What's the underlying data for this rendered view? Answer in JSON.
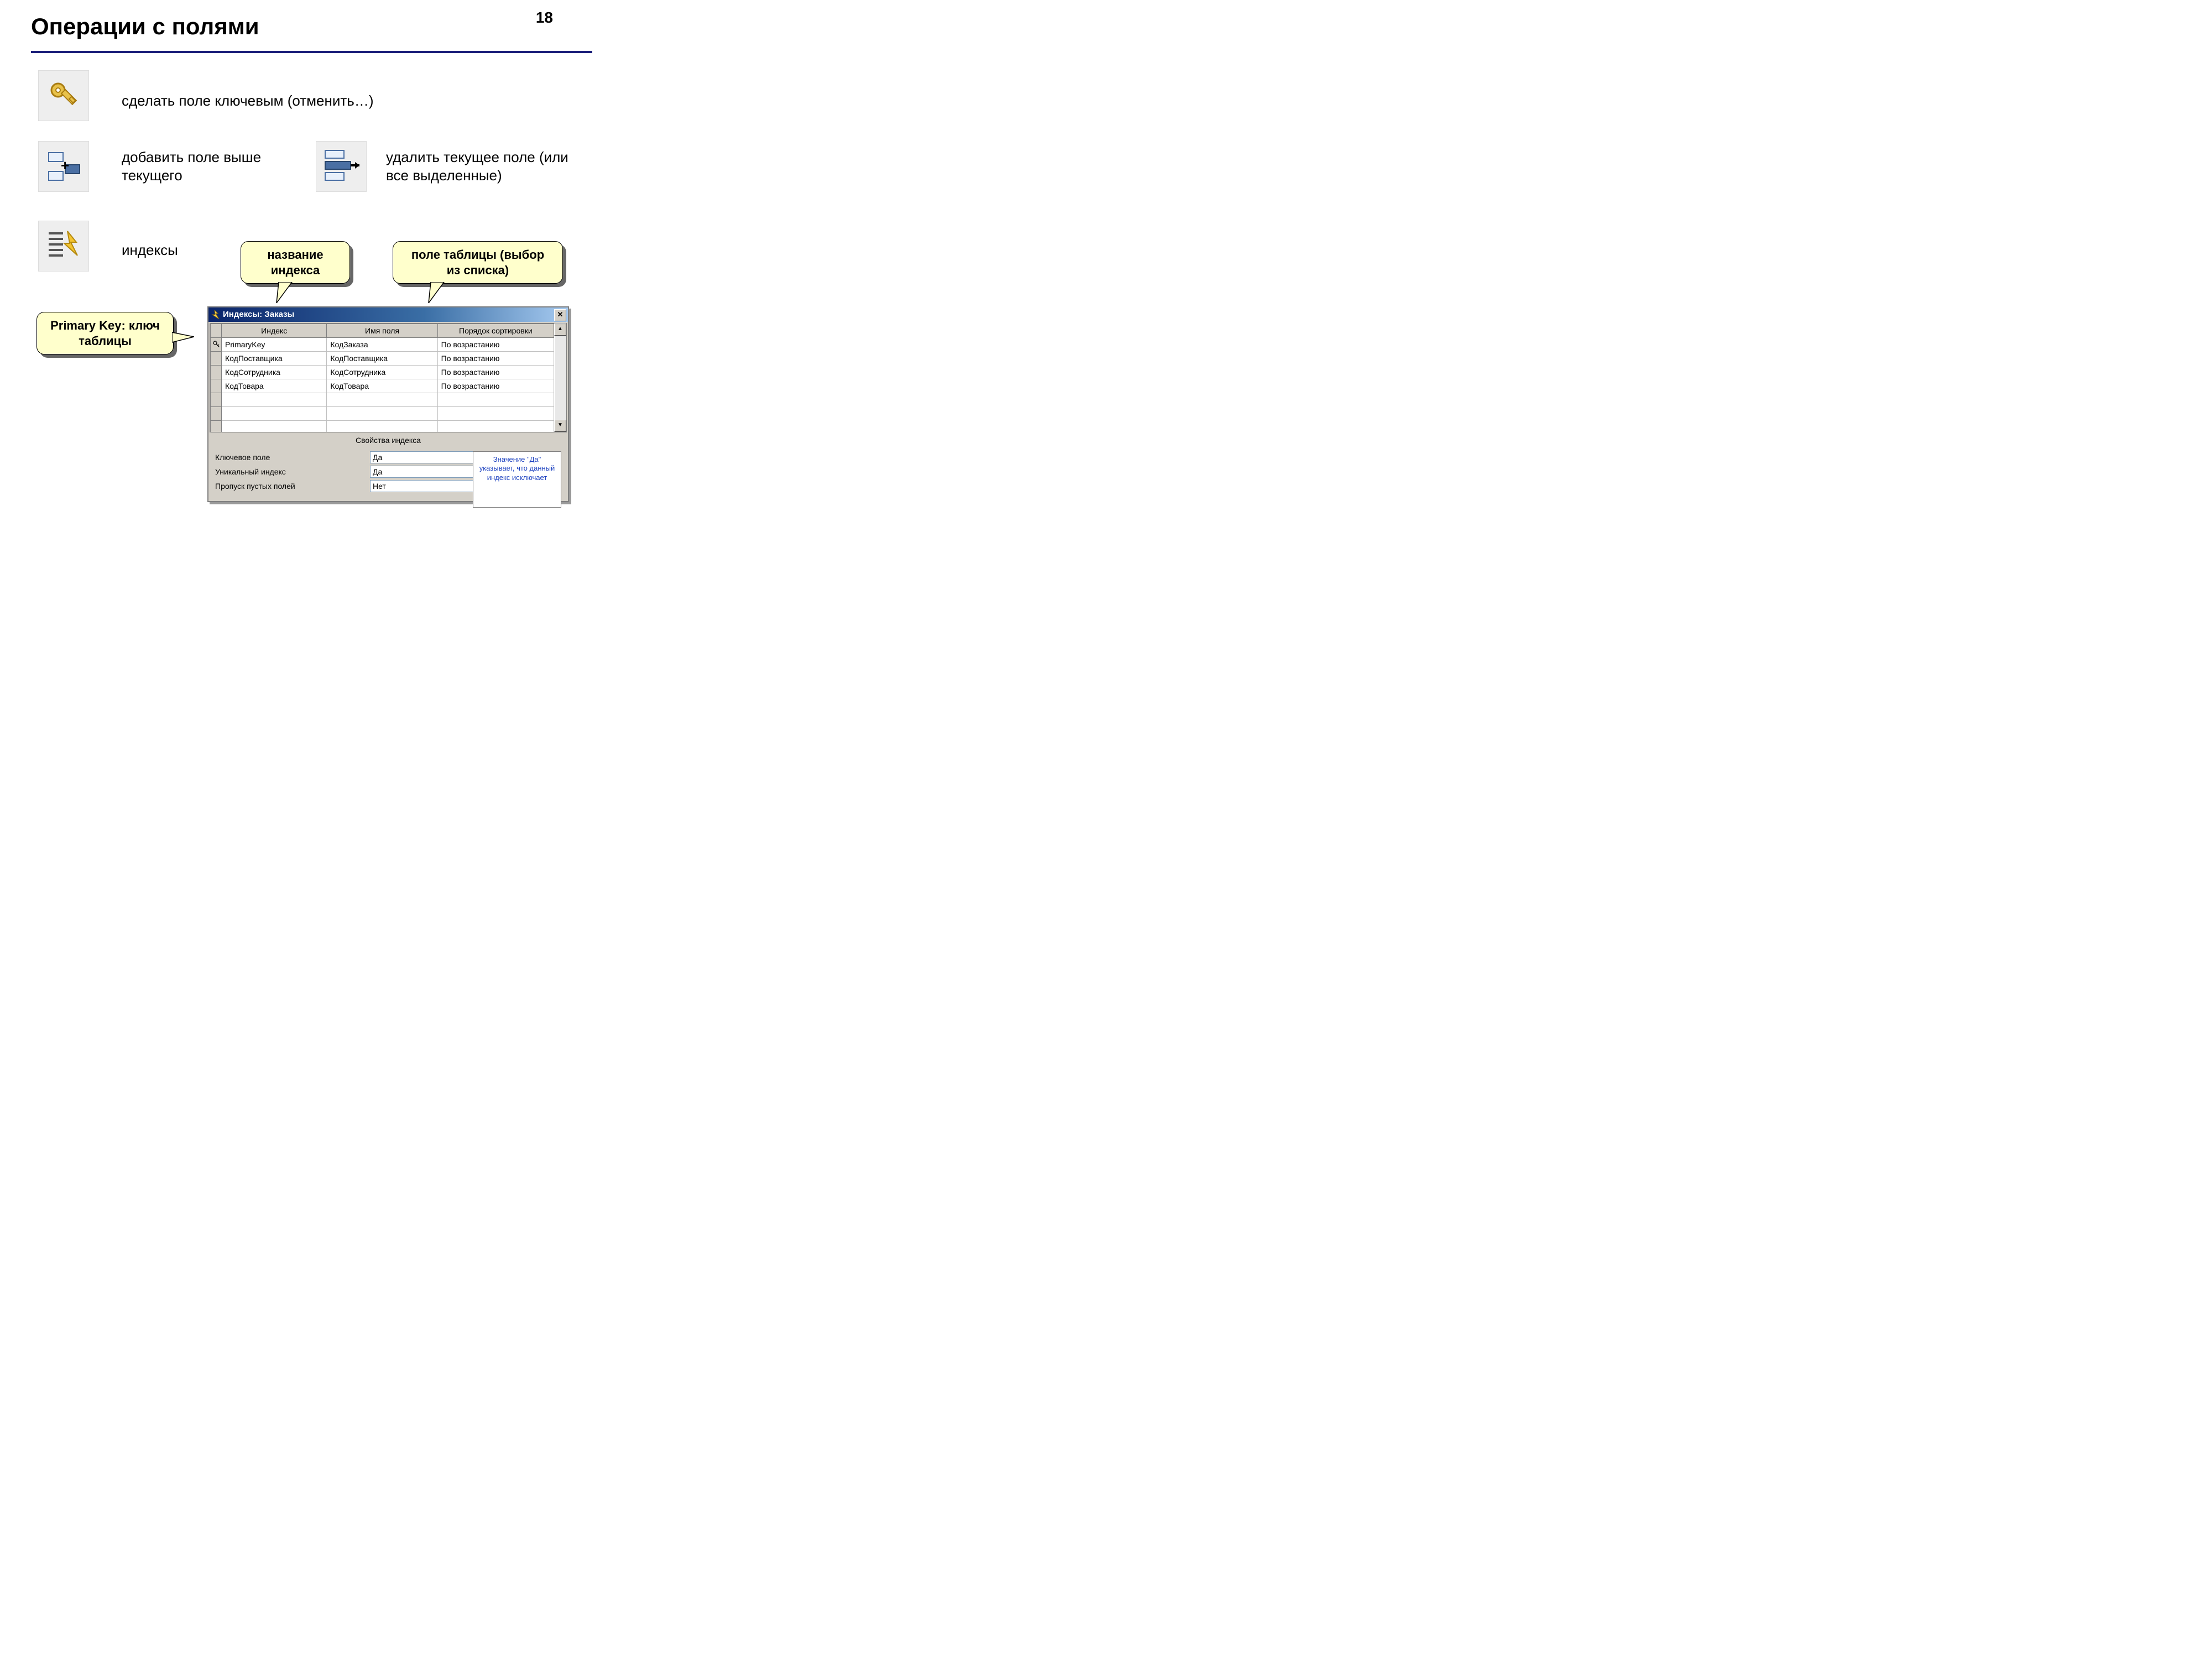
{
  "page_number": "18",
  "title": "Операции с полями",
  "ops": {
    "make_key": "сделать поле ключевым (отменить…)",
    "add_above": "добавить поле выше текущего",
    "delete_current": "удалить текущее поле (или все выделенные)",
    "indexes": "индексы"
  },
  "callouts": {
    "primary_key": "Primary Key: ключ таблицы",
    "index_name": "название индекса",
    "table_field": "поле таблицы (выбор из списка)"
  },
  "dialog": {
    "title": "Индексы: Заказы",
    "columns": [
      "Индекс",
      "Имя поля",
      "Порядок сортировки"
    ],
    "rows": [
      {
        "key": true,
        "index": "PrimaryKey",
        "field": "КодЗаказа",
        "order": "По возрастанию"
      },
      {
        "key": false,
        "index": "КодПоставщика",
        "field": "КодПоставщика",
        "order": "По возрастанию"
      },
      {
        "key": false,
        "index": "КодСотрудника",
        "field": "КодСотрудника",
        "order": "По возрастанию"
      },
      {
        "key": false,
        "index": "КодТовара",
        "field": "КодТовара",
        "order": "По возрастанию"
      }
    ],
    "props_title": "Свойства индекса",
    "props": [
      {
        "label": "Ключевое поле",
        "value": "Да",
        "dropdown": false
      },
      {
        "label": "Уникальный индекс",
        "value": "Да",
        "dropdown": false
      },
      {
        "label": "Пропуск пустых полей",
        "value": "Нет",
        "dropdown": true
      }
    ],
    "hint": "Значение \"Да\" указывает, что данный индекс исключает"
  }
}
